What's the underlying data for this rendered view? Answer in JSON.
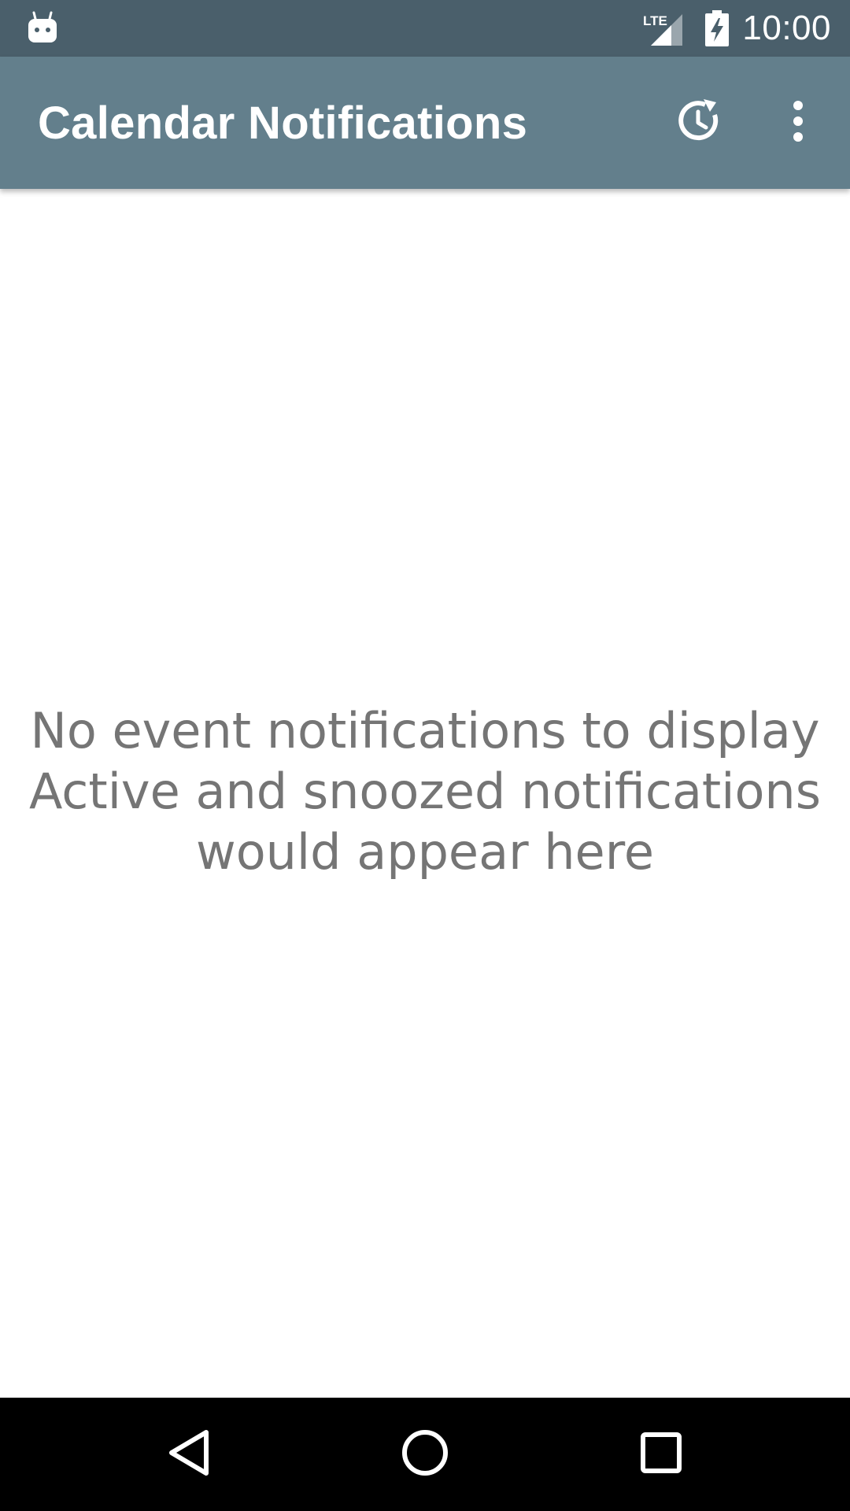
{
  "status_bar": {
    "time": "10:00",
    "network_label": "LTE",
    "icons": [
      "android-app-icon",
      "lte-signal-icon",
      "battery-charging-icon"
    ]
  },
  "app_bar": {
    "title": "Calendar Notifications",
    "actions": [
      {
        "icon": "snooze-clock-icon"
      },
      {
        "icon": "more-vert-icon"
      }
    ]
  },
  "empty_state": {
    "line1": "No event notifications to display",
    "line2": "Active and snoozed notifications",
    "line3": "would appear here"
  },
  "nav_bar": {
    "buttons": [
      "back-icon",
      "home-icon",
      "recents-icon"
    ]
  },
  "colors": {
    "status_bar": "#4a5f6b",
    "app_bar": "#637f8c",
    "empty_text": "#757575",
    "nav_bar": "#000000"
  }
}
